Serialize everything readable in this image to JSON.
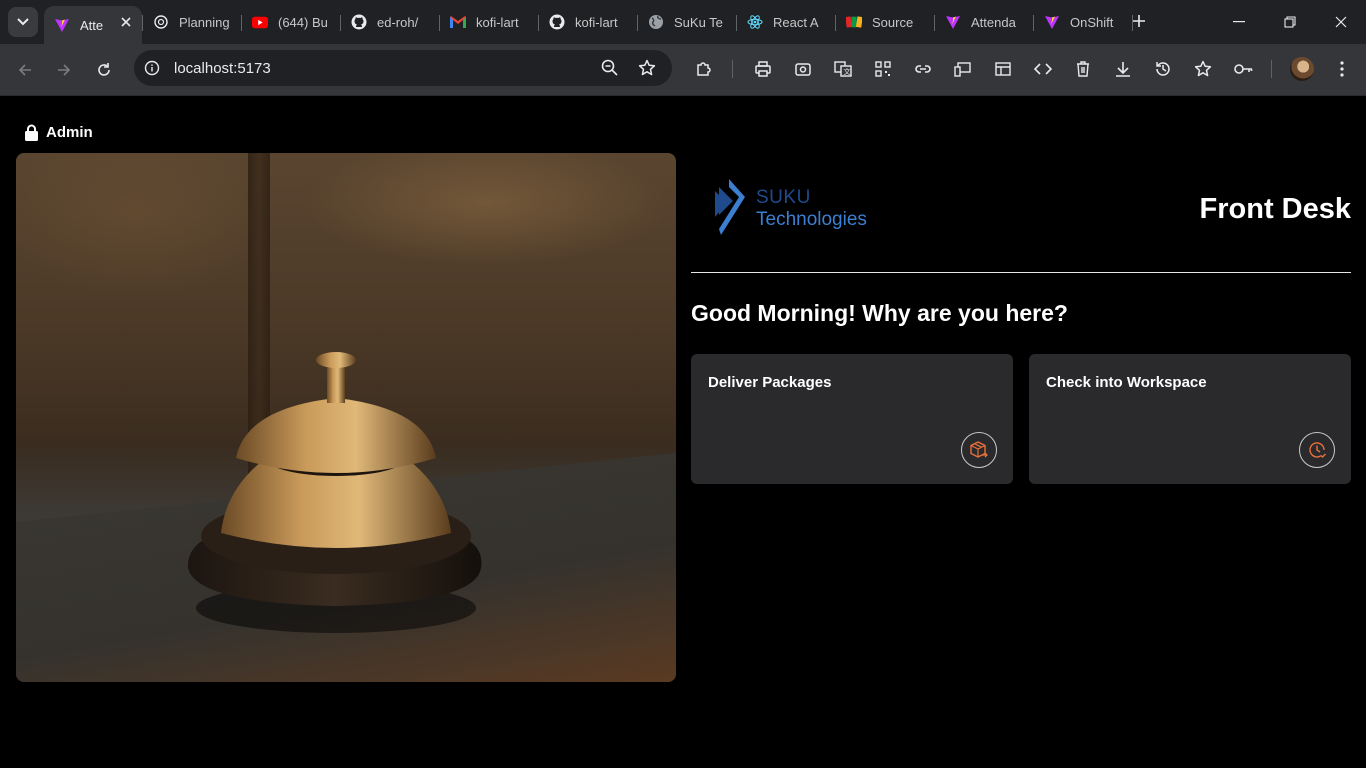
{
  "browser": {
    "tabs": [
      {
        "title": "Atte",
        "icon": "vite-icon",
        "active": true
      },
      {
        "title": "Planning",
        "icon": "openai-icon"
      },
      {
        "title": "(644) Bu",
        "icon": "youtube-icon"
      },
      {
        "title": "ed-roh/",
        "icon": "github-icon"
      },
      {
        "title": "kofi-lart",
        "icon": "gmail-icon"
      },
      {
        "title": "kofi-lart",
        "icon": "github-icon"
      },
      {
        "title": "SuKu Te",
        "icon": "globe-icon"
      },
      {
        "title": "React A",
        "icon": "react-icon"
      },
      {
        "title": "Source",
        "icon": "zoho-icon"
      },
      {
        "title": "Attenda",
        "icon": "vite-icon"
      },
      {
        "title": "OnShift",
        "icon": "vite-icon"
      }
    ],
    "url": "localhost:5173"
  },
  "page": {
    "admin_label": "Admin",
    "logo": {
      "line1": "SUKU",
      "line2": "Technologies"
    },
    "title": "Front Desk",
    "greeting": "Good Morning! Why are you here?",
    "options": [
      {
        "label": "Deliver Packages",
        "icon": "package-icon"
      },
      {
        "label": "Check into Workspace",
        "icon": "clock-icon"
      }
    ]
  },
  "colors": {
    "accent_orange": "#e8703a",
    "logo_dark_blue": "#1f4a8c",
    "logo_light_blue": "#3c7fd1",
    "card_bg": "#2a2a2d"
  }
}
